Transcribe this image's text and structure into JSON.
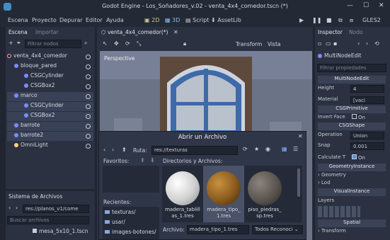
{
  "window": {
    "title": "Godot Engine - Los_Soñadores_v.02 - venta_4x4_comedor.tscn (*)"
  },
  "menubar": {
    "items": [
      "Escena",
      "Proyecto",
      "Depurar",
      "Editor",
      "Ayuda"
    ]
  },
  "workspace": {
    "tabs": [
      "2D",
      "3D",
      "Script",
      "AssetLib"
    ],
    "renderer": "GLES2"
  },
  "left_panel": {
    "tabs": [
      "Escena",
      "Importar"
    ],
    "filter_placeholder": "Filtrar nodos",
    "tree": [
      {
        "label": "venta_4x4_comedor",
        "depth": 0,
        "kind": "spatial"
      },
      {
        "label": "bloque_pared",
        "depth": 1,
        "kind": "csg"
      },
      {
        "label": "CSGCylinder",
        "depth": 2,
        "kind": "csg"
      },
      {
        "label": "CSGBox2",
        "depth": 2,
        "kind": "csg"
      },
      {
        "label": "marco",
        "depth": 1,
        "kind": "csg"
      },
      {
        "label": "CSGCylinder",
        "depth": 2,
        "kind": "csg"
      },
      {
        "label": "CSGBox2",
        "depth": 2,
        "kind": "csg"
      },
      {
        "label": "barrote",
        "depth": 1,
        "kind": "csg"
      },
      {
        "label": "barrote2",
        "depth": 1,
        "kind": "csg"
      },
      {
        "label": "OmniLight",
        "depth": 1,
        "kind": "light"
      }
    ],
    "filesystem_title": "Sistema de Archivos",
    "fs_path": "res://planos_v1/come",
    "fs_search_placeholder": "Buscar archivos",
    "fs_item": "mesa_5x10_1.tscn"
  },
  "editor": {
    "scene_tab": "venta_4x4_comedor(*)",
    "toolbar_transform": "Transform",
    "toolbar_view": "Vista",
    "viewport_label": "Perspective"
  },
  "inspector": {
    "tabs": [
      "Inspector",
      "Nodo"
    ],
    "object": "MultiNodeEdit",
    "filter_placeholder": "Filtrar propiedades",
    "selected": "MultiNodeEdit",
    "height_label": "Height",
    "height_value": "4",
    "material_label": "Material",
    "material_value": "[vaci",
    "csg_primitive": "CSGPrimitive",
    "invert_face_label": "Invert Face",
    "invert_face_value": "On",
    "csg_shape": "CSGShape",
    "operation_label": "Operation",
    "operation_value": "Union",
    "snap_label": "Snap",
    "snap_value": "0.001",
    "calc_label": "Calculate T",
    "calc_value": "On",
    "geometry_instance": "GeometryInstance",
    "geometry": "Geometry",
    "lod": "Lod",
    "visual_instance": "VisualInstance",
    "layers": "Layers",
    "spatial": "Spatial",
    "transform": "Transform"
  },
  "dialog": {
    "title": "Abrir un Archivo",
    "path_label": "Ruta:",
    "path_value": "res://texturas",
    "favorites_label": "Favoritos:",
    "dirs_label": "Directorios y Archivos:",
    "recents_label": "Recientes:",
    "recents": [
      "texturas/",
      "usar/",
      "images-botones/"
    ],
    "files": [
      {
        "name": "madera_tablill\nas_1.tres",
        "selected": false,
        "color": "#e6e6e6"
      },
      {
        "name": "madera_tipo_\n1.tres",
        "selected": true,
        "color": "#8a5a1e"
      },
      {
        "name": "piso_piedras_\nsp.tres",
        "selected": false,
        "color": "#5a5550"
      }
    ],
    "file_label": "Archivo:",
    "file_value": "madera_tipo_1.tres",
    "filter_value": "Todos Reconoci"
  }
}
